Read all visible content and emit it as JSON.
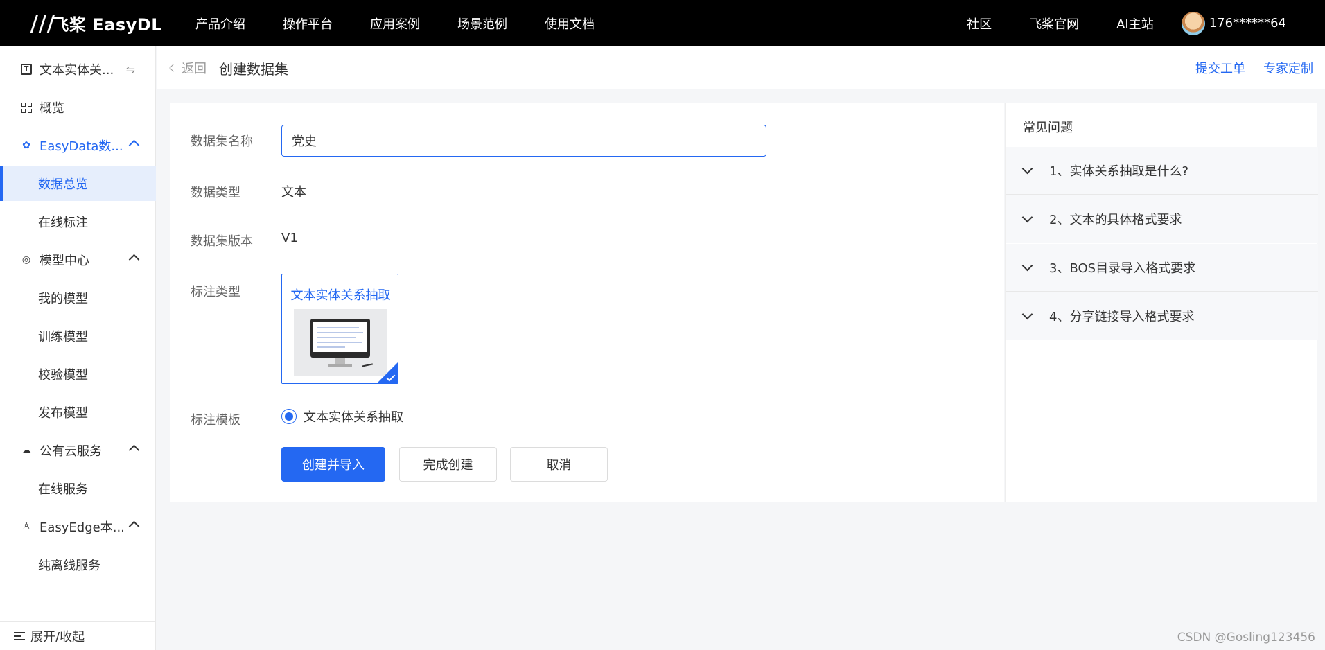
{
  "topbar": {
    "logo_text": "飞桨 EasyDL",
    "nav": [
      "产品介绍",
      "操作平台",
      "应用案例",
      "场景范例",
      "使用文档"
    ],
    "right_nav": [
      "社区",
      "飞桨官网",
      "AI主站"
    ],
    "user_name": "176******64"
  },
  "sidebar": {
    "project": "文本实体关...",
    "overview": "概览",
    "easydata": "EasyData数...",
    "data_overview": "数据总览",
    "online_label": "在线标注",
    "model_center": "模型中心",
    "my_model": "我的模型",
    "train_model": "训练模型",
    "verify_model": "校验模型",
    "publish_model": "发布模型",
    "public_cloud": "公有云服务",
    "online_service": "在线服务",
    "easyedge": "EasyEdge本...",
    "offline_service": "纯离线服务",
    "toggle": "展开/收起"
  },
  "header": {
    "back": "返回",
    "title": "创建数据集",
    "submit_ticket": "提交工单",
    "expert": "专家定制"
  },
  "form": {
    "name_label": "数据集名称",
    "name_value": "党史",
    "type_label": "数据类型",
    "type_value": "文本",
    "version_label": "数据集版本",
    "version_value": "V1",
    "annot_type_label": "标注类型",
    "annot_type_card": "文本实体关系抽取",
    "template_label": "标注模板",
    "template_option": "文本实体关系抽取",
    "btn_create_import": "创建并导入",
    "btn_finish": "完成创建",
    "btn_cancel": "取消"
  },
  "faq": {
    "title": "常见问题",
    "items": [
      "1、实体关系抽取是什么?",
      "2、文本的具体格式要求",
      "3、BOS目录导入格式要求",
      "4、分享链接导入格式要求"
    ]
  },
  "watermark": "CSDN @Gosling123456",
  "colors": {
    "accent": "#2468f2",
    "topbar": "#000000"
  }
}
